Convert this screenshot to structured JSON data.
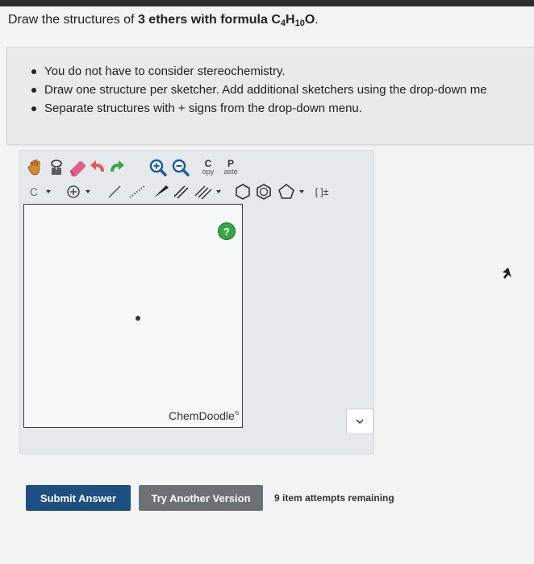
{
  "question": {
    "prefix": "Draw the structures of ",
    "count": "3 ethers",
    "middle": " with formula ",
    "formula_c": "C",
    "formula_c_sub": "4",
    "formula_h": "H",
    "formula_h_sub": "10",
    "formula_o": "O",
    "period": "."
  },
  "instructions": [
    "You do not have to consider stereochemistry.",
    "Draw one structure per sketcher. Add additional sketchers using the drop-down me",
    "Separate structures with + signs from the drop-down menu."
  ],
  "toolbar": {
    "copy_top": "C",
    "copy_bottom": "opy",
    "paste_top": "P",
    "paste_bottom": "aste",
    "element_label": "C",
    "bracket_label": "[ ]±"
  },
  "canvas": {
    "help_label": "?",
    "brand": "ChemDoodle",
    "brand_mark": "®"
  },
  "actions": {
    "submit_label": "Submit Answer",
    "try_label": "Try Another Version",
    "attempts_text": "9 item attempts remaining"
  },
  "colors": {
    "submit": "#1d4f82",
    "try": "#6c7174",
    "help": "#39a54a"
  }
}
